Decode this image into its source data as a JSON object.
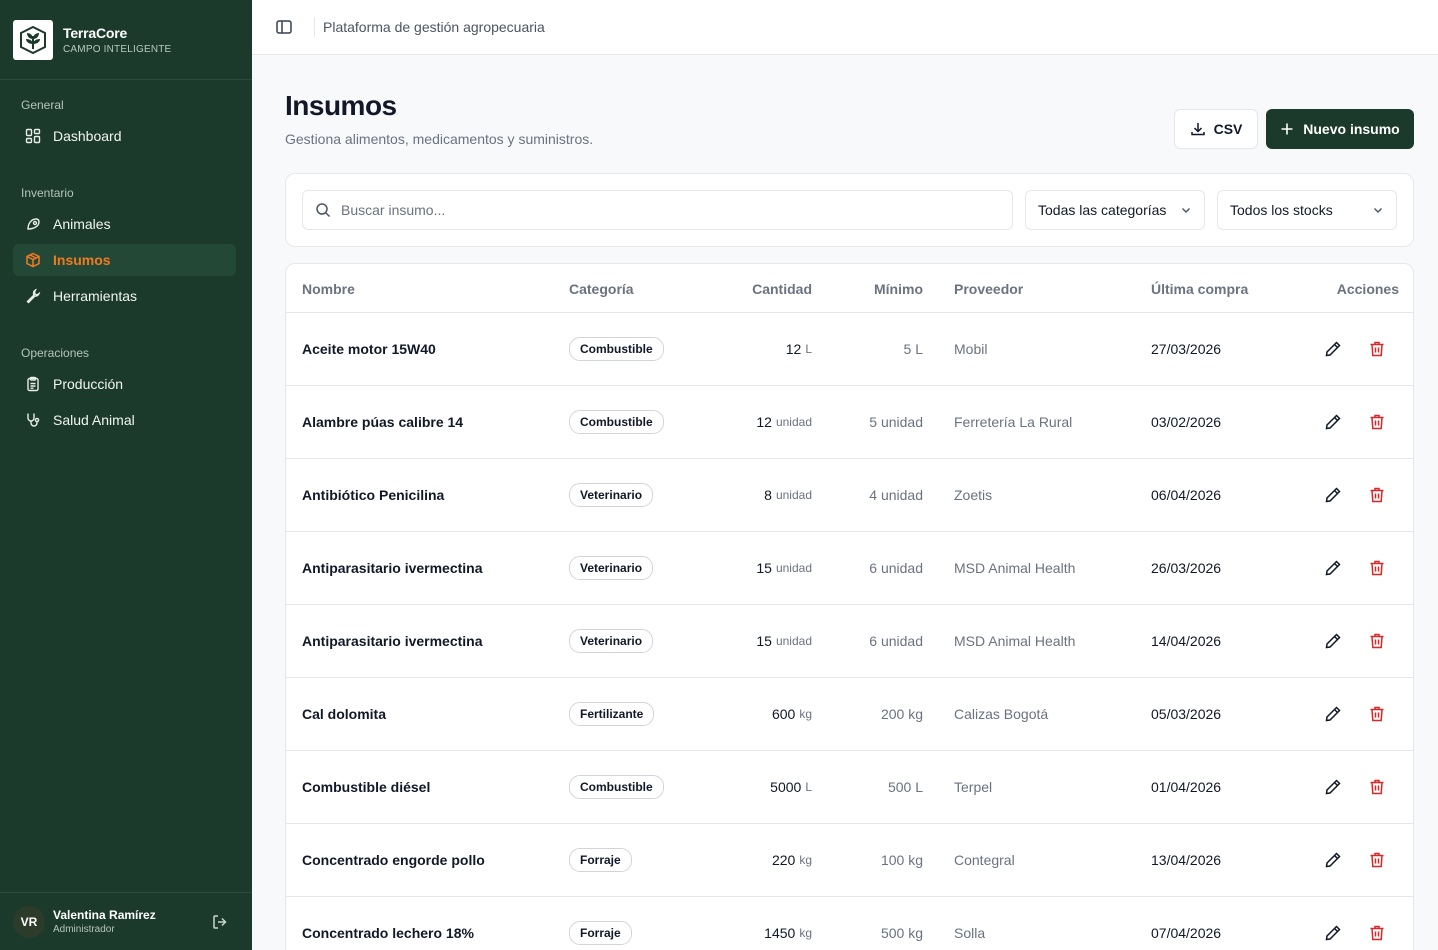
{
  "brand": {
    "name": "TerraCore",
    "tagline": "CAMPO INTELIGENTE"
  },
  "sidebar": {
    "sections": [
      {
        "label": "General"
      },
      {
        "label": "Inventario"
      },
      {
        "label": "Operaciones"
      }
    ],
    "items": [
      {
        "label": "Dashboard",
        "icon": "dashboard-icon"
      },
      {
        "label": "Animales",
        "icon": "paw-icon"
      },
      {
        "label": "Insumos",
        "icon": "package-icon",
        "active": true
      },
      {
        "label": "Herramientas",
        "icon": "wrench-icon"
      },
      {
        "label": "Producción",
        "icon": "clipboard-icon"
      },
      {
        "label": "Salud Animal",
        "icon": "stethoscope-icon"
      }
    ]
  },
  "user": {
    "initials": "VR",
    "name": "Valentina Ramírez",
    "role": "Administrador"
  },
  "topbar": {
    "title": "Plataforma de gestión agropecuaria"
  },
  "page": {
    "title": "Insumos",
    "subtitle": "Gestiona alimentos, medicamentos y suministros.",
    "csv_label": "CSV",
    "new_label": "Nuevo insumo"
  },
  "filters": {
    "search_placeholder": "Buscar insumo...",
    "category_value": "Todas las categorías",
    "stock_value": "Todos los stocks"
  },
  "table": {
    "columns": [
      "Nombre",
      "Categoría",
      "Cantidad",
      "Mínimo",
      "Proveedor",
      "Última compra",
      "Acciones"
    ],
    "rows": [
      {
        "name": "Aceite motor 15W40",
        "category": "Combustible",
        "qty": "12",
        "qty_unit": "L",
        "min": "5 L",
        "provider": "Mobil",
        "last": "27/03/2026"
      },
      {
        "name": "Alambre púas calibre 14",
        "category": "Combustible",
        "qty": "12",
        "qty_unit": "unidad",
        "min": "5 unidad",
        "provider": "Ferretería La Rural",
        "last": "03/02/2026"
      },
      {
        "name": "Antibiótico Penicilina",
        "category": "Veterinario",
        "qty": "8",
        "qty_unit": "unidad",
        "min": "4 unidad",
        "provider": "Zoetis",
        "last": "06/04/2026"
      },
      {
        "name": "Antiparasitario ivermectina",
        "category": "Veterinario",
        "qty": "15",
        "qty_unit": "unidad",
        "min": "6 unidad",
        "provider": "MSD Animal Health",
        "last": "26/03/2026"
      },
      {
        "name": "Antiparasitario ivermectina",
        "category": "Veterinario",
        "qty": "15",
        "qty_unit": "unidad",
        "min": "6 unidad",
        "provider": "MSD Animal Health",
        "last": "14/04/2026"
      },
      {
        "name": "Cal dolomita",
        "category": "Fertilizante",
        "qty": "600",
        "qty_unit": "kg",
        "min": "200 kg",
        "provider": "Calizas Bogotá",
        "last": "05/03/2026"
      },
      {
        "name": "Combustible diésel",
        "category": "Combustible",
        "qty": "5000",
        "qty_unit": "L",
        "min": "500 L",
        "provider": "Terpel",
        "last": "01/04/2026"
      },
      {
        "name": "Concentrado engorde pollo",
        "category": "Forraje",
        "qty": "220",
        "qty_unit": "kg",
        "min": "100 kg",
        "provider": "Contegral",
        "last": "13/04/2026"
      },
      {
        "name": "Concentrado lechero 18%",
        "category": "Forraje",
        "qty": "1450",
        "qty_unit": "kg",
        "min": "500 kg",
        "provider": "Solla",
        "last": "07/04/2026"
      }
    ]
  },
  "colors": {
    "sidebar_bg": "#1b3a2b",
    "accent": "#f07a22",
    "danger": "#dc2626",
    "primary_button": "#1b3a2b"
  }
}
